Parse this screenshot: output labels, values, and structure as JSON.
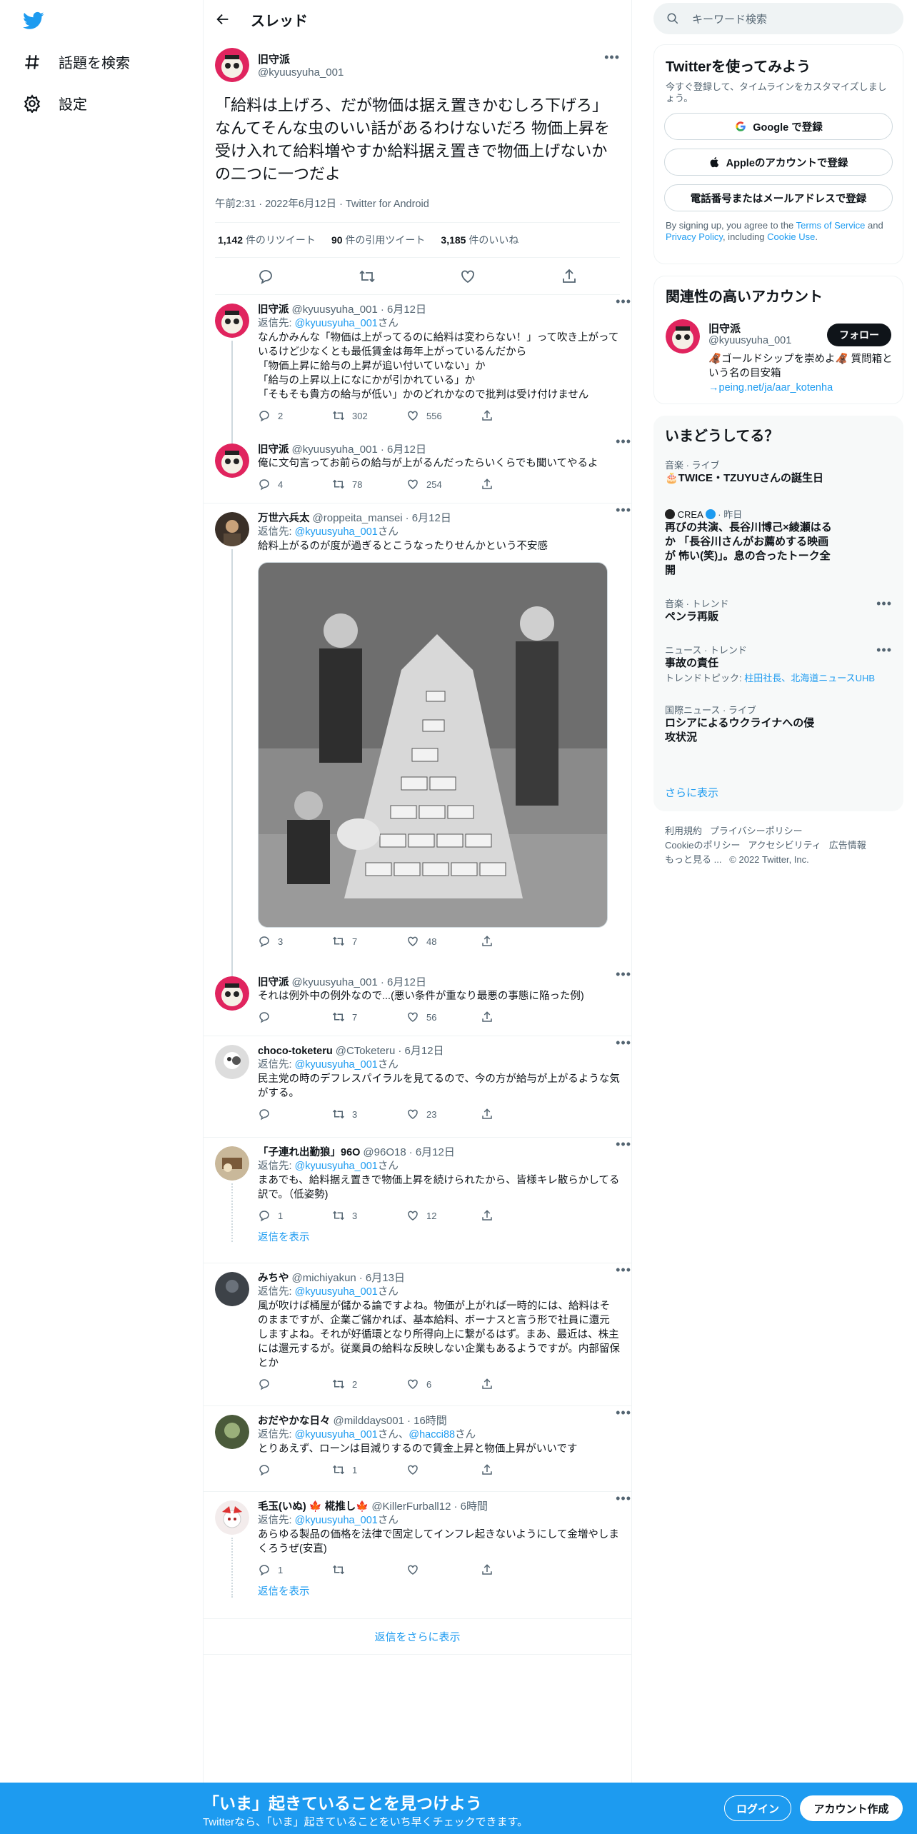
{
  "nav": {
    "explore": "話題を検索",
    "settings": "設定"
  },
  "header": {
    "title": "スレッド"
  },
  "focal": {
    "name": "旧守派",
    "handle": "@kyuusyuha_001",
    "text": "「給料は上げろ、だが物価は据え置きかむしろ下げろ」なんてそんな虫のいい話があるわけないだろ 物価上昇を受け入れて給料増やすか給料据え置きで物価上げないかの二つに一つだよ",
    "meta": "午前2:31 · 2022年6月12日 · Twitter for Android",
    "retweets": "1,142",
    "retweets_label": "件のリツイート",
    "quotes": "90",
    "quotes_label": "件の引用ツイート",
    "likes": "3,185",
    "likes_label": "件のいいね"
  },
  "replies": [
    {
      "name": "旧守派",
      "handle": "@kyuusyuha_001",
      "date": "· 6月12日",
      "reply_prefix": "返信先: ",
      "reply_to": "@kyuusyuha_001",
      "reply_suffix": "さん",
      "lines": [
        "なんかみんな「物価は上がってるのに給料は変わらない！」って吹き上がっているけど少なくとも最低賃金は毎年上がっているんだから",
        "「物価上昇に給与の上昇が追い付いていない」か",
        "「給与の上昇以上になにかが引かれている」か",
        "「そもそも貴方の給与が低い」かのどれかなので批判は受け付けません"
      ],
      "reply": "2",
      "retweet": "302",
      "like": "556"
    },
    {
      "name": "旧守派",
      "handle": "@kyuusyuha_001",
      "date": "· 6月12日",
      "text": "俺に文句言ってお前らの給与が上がるんだったらいくらでも聞いてやるよ",
      "reply": "4",
      "retweet": "78",
      "like": "254"
    },
    {
      "name": "万世六兵太",
      "handle": "@roppeita_mansei",
      "date": "· 6月12日",
      "reply_prefix": "返信先: ",
      "reply_to": "@kyuusyuha_001",
      "reply_suffix": "さん",
      "text": "給料上がるのが度が過ぎるとこうなったりせんかという不安感",
      "reply": "3",
      "retweet": "7",
      "like": "48"
    },
    {
      "name": "旧守派",
      "handle": "@kyuusyuha_001",
      "date": "· 6月12日",
      "text": "それは例外中の例外なので...(悪い条件が重なり最悪の事態に陥った例)",
      "reply": "",
      "retweet": "7",
      "like": "56"
    },
    {
      "name": "choco-toketeru",
      "handle": "@CToketeru",
      "date": "· 6月12日",
      "reply_prefix": "返信先: ",
      "reply_to": "@kyuusyuha_001",
      "reply_suffix": "さん",
      "text": "民主党の時のデフレスパイラルを見てるので、今の方が給与が上がるような気がする。",
      "reply": "",
      "retweet": "3",
      "like": "23"
    },
    {
      "name": "「子連れ出勤狼」96O",
      "handle": "@96O18",
      "date": "· 6月12日",
      "reply_prefix": "返信先: ",
      "reply_to": "@kyuusyuha_001",
      "reply_suffix": "さん",
      "text": "まあでも、給料据え置きで物価上昇を続けられたから、皆様キレ散らかしてる訳で。（低姿勢)",
      "reply": "1",
      "retweet": "3",
      "like": "12",
      "show": "返信を表示"
    },
    {
      "name": "みちや",
      "handle": "@michiyakun",
      "date": "· 6月13日",
      "reply_prefix": "返信先: ",
      "reply_to": "@kyuusyuha_001",
      "reply_suffix": "さん",
      "text": "風が吹けば桶屋が儲かる論ですよね。物価が上がれば一時的には、給料はそのままですが、企業ご儲かれば、基本給料、ボーナスと言う形で社員に還元しますよね。それが好循環となり所得向上に繋がるはず。まあ、最近は、株主には還元するが。従業員の給料な反映しない企業もあるようですが。内部留保とか",
      "reply": "",
      "retweet": "2",
      "like": "6"
    },
    {
      "name": "おだやかな日々",
      "handle": "@milddays001",
      "date": "· 16時間",
      "reply_prefix": "返信先: ",
      "reply_to": "@kyuusyuha_001",
      "reply_mid": "さん、",
      "reply_to2": "@hacci88",
      "reply_suffix": "さん",
      "text": "とりあえず、ローンは目減りするので賃金上昇と物価上昇がいいです",
      "reply": "",
      "retweet": "1",
      "like": ""
    },
    {
      "name": "毛玉(いぬ) 🍁 椛推し🍁",
      "handle": "@KillerFurball12",
      "date": "· 6時間",
      "reply_prefix": "返信先: ",
      "reply_to": "@kyuusyuha_001",
      "reply_suffix": "さん",
      "text": "あらゆる製品の価格を法律で固定してインフレ起きないようにして金増やしまくろうぜ(安直)",
      "reply": "1",
      "retweet": "",
      "like": "",
      "show": "返信を表示"
    }
  ],
  "more_replies": "返信をさらに表示",
  "right": {
    "search_placeholder": "キーワード検索",
    "signup": {
      "title": "Twitterを使ってみよう",
      "desc": "今すぐ登録して、タイムラインをカスタマイズしましょう。",
      "google": "Google で登録",
      "apple": "Appleのアカウントで登録",
      "phone": "電話番号またはメールアドレスで登録",
      "legal_pre": "By signing up, you agree to the ",
      "tos": "Terms of Service",
      "and": " and ",
      "privacy": "Privacy Policy",
      "including": ", including ",
      "cookie": "Cookie Use",
      "period": "."
    },
    "relevant": {
      "title": "関連性の高いアカウント",
      "name": "旧守派",
      "handle": "@kyuusyuha_001",
      "follow": "フォロー",
      "bio": "🦧ゴールドシップを崇めよ🦧 質問箱という名の目安箱",
      "bio_link": "→peing.net/ja/aar_kotenha"
    },
    "trends": {
      "title": "いまどうしてる？",
      "items": [
        {
          "cat": "音楽 · ライブ",
          "title": "🎂TWICE・TZUYUさんの誕生日"
        },
        {
          "source": "CREA",
          "time": "· 昨日",
          "title": "再びの共演、長谷川博己×綾瀬はるか 「長谷川さんがお薦めする映画が 怖い(笑)」。息の合ったトーク全開"
        },
        {
          "cat": "音楽 · トレンド",
          "title": "ペンラ再販"
        },
        {
          "cat": "ニュース · トレンド",
          "title": "事故の責任",
          "topic_label": "トレンドトピック: ",
          "topic": "柱田社長、北海道ニュースUHB"
        },
        {
          "cat": "国際ニュース · ライブ",
          "title": "ロシアによるウクライナへの侵攻状況"
        }
      ],
      "show_more": "さらに表示"
    },
    "footer": {
      "line1": [
        "利用規約",
        "プライバシーポリシー"
      ],
      "line2": [
        "Cookieのポリシー",
        "アクセシビリティ",
        "広告情報"
      ],
      "more": "もっと見る ...",
      "copyright": "© 2022 Twitter, Inc."
    }
  },
  "bottom": {
    "headline": "「いま」起きていることを見つけよう",
    "sub": "Twitterなら、「いま」起きていることをいち早くチェックできます。",
    "login": "ログイン",
    "signup": "アカウント作成"
  },
  "colors": {
    "accent": "#1d9bf0",
    "text": "#0f1419",
    "muted": "#536471"
  }
}
